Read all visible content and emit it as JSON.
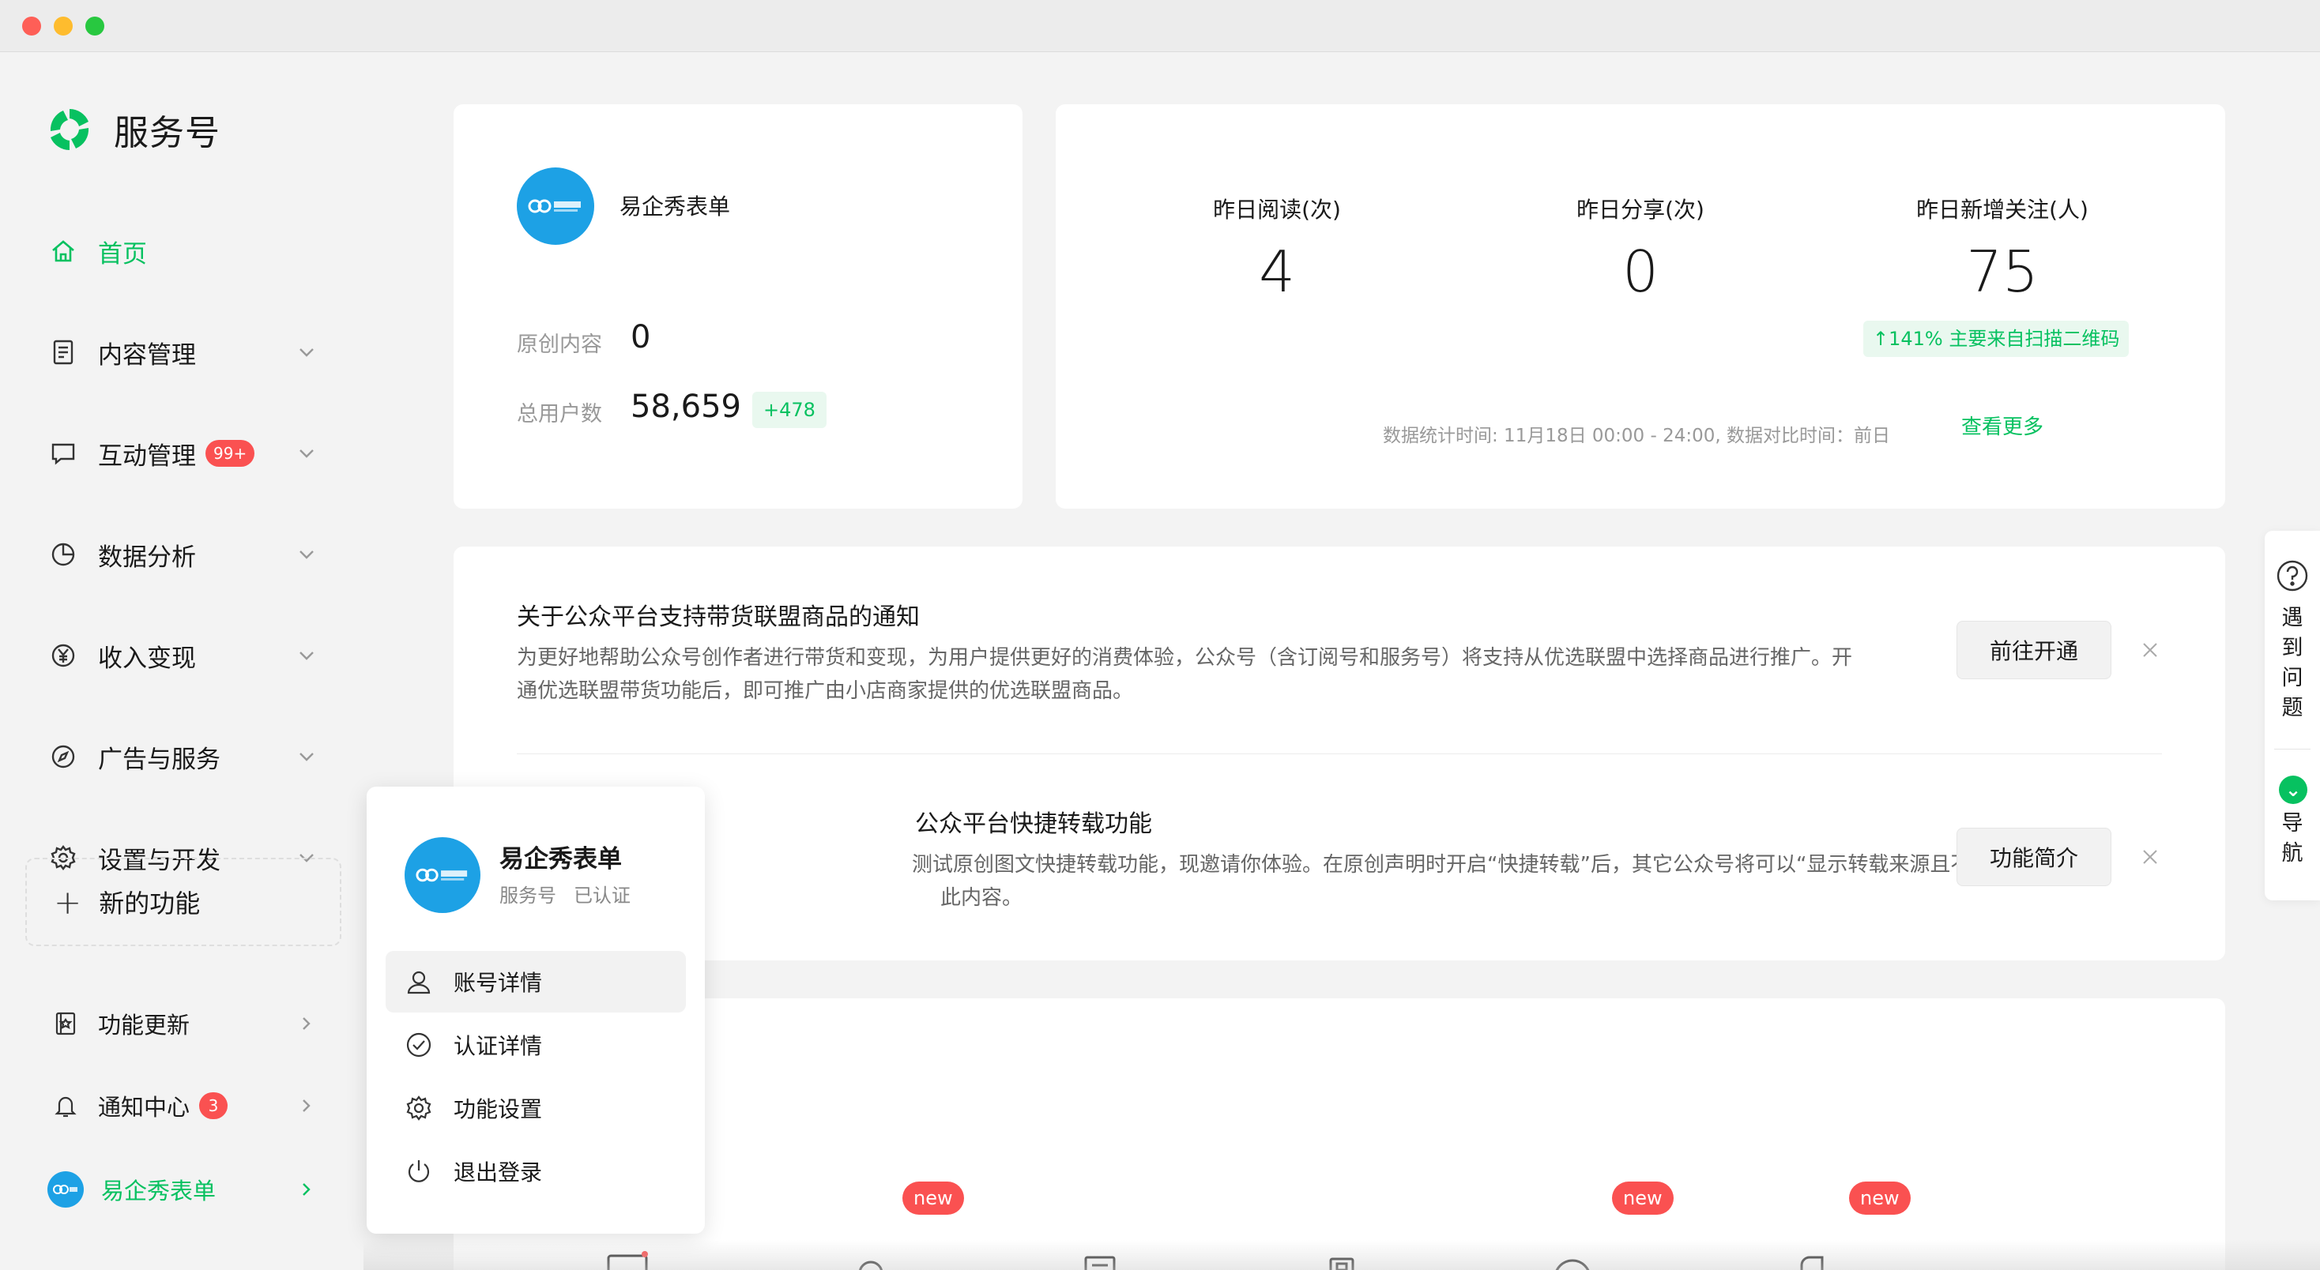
{
  "brand": {
    "name": "服务号"
  },
  "nav": {
    "home": "首页",
    "content": "内容管理",
    "interaction": "互动管理",
    "interaction_badge": "99+",
    "data": "数据分析",
    "income": "收入变现",
    "ads": "广告与服务",
    "settings": "设置与开发",
    "new_features": "新的功能",
    "updates": "功能更新",
    "notifications": "通知中心",
    "notifications_badge": "3",
    "account": "易企秀表单"
  },
  "profile": {
    "name": "易企秀表单",
    "original_label": "原创内容",
    "original_value": "0",
    "users_label": "总用户数",
    "users_value": "58,659",
    "users_delta": "+478"
  },
  "stats": {
    "items": [
      {
        "label": "昨日阅读(次)",
        "value": "4"
      },
      {
        "label": "昨日分享(次)",
        "value": "0"
      },
      {
        "label": "昨日新增关注(人)",
        "value": "75"
      }
    ],
    "growth_tag": "↑141%   主要来自扫描二维码",
    "note": "数据统计时间: 11月18日 00:00 - 24:00, 数据对比时间：前日",
    "more": "查看更多"
  },
  "notices": [
    {
      "title": "关于公众平台支持带货联盟商品的通知",
      "body": "为更好地帮助公众号创作者进行带货和变现，为用户提供更好的消费体验，公众号（含订阅号和服务号）将支持从优选联盟中选择商品进行推广。开通优选联盟带货功能后，即可推广由小店商家提供的优选联盟商品。",
      "button": "前往开通"
    },
    {
      "title": "公众平台快捷转载功能",
      "body": "测试原创图文快捷转载功能，现邀请你体验。在原创声明时开启“快捷转载”后，其它公众号将可以“显示转载来源且不允",
      "body2": "此内容。",
      "button": "功能简介"
    }
  ],
  "bottom": {
    "new_label": "new"
  },
  "helper": {
    "problem_chars": [
      "遇",
      "到",
      "问",
      "题"
    ],
    "nav_chars": [
      "导",
      "航"
    ]
  },
  "popover": {
    "name": "易企秀表单",
    "type": "服务号",
    "status": "已认证",
    "items": [
      "账号详情",
      "认证详情",
      "功能设置",
      "退出登录"
    ]
  },
  "colors": {
    "accent": "#07c160",
    "badge": "#fa5151"
  }
}
